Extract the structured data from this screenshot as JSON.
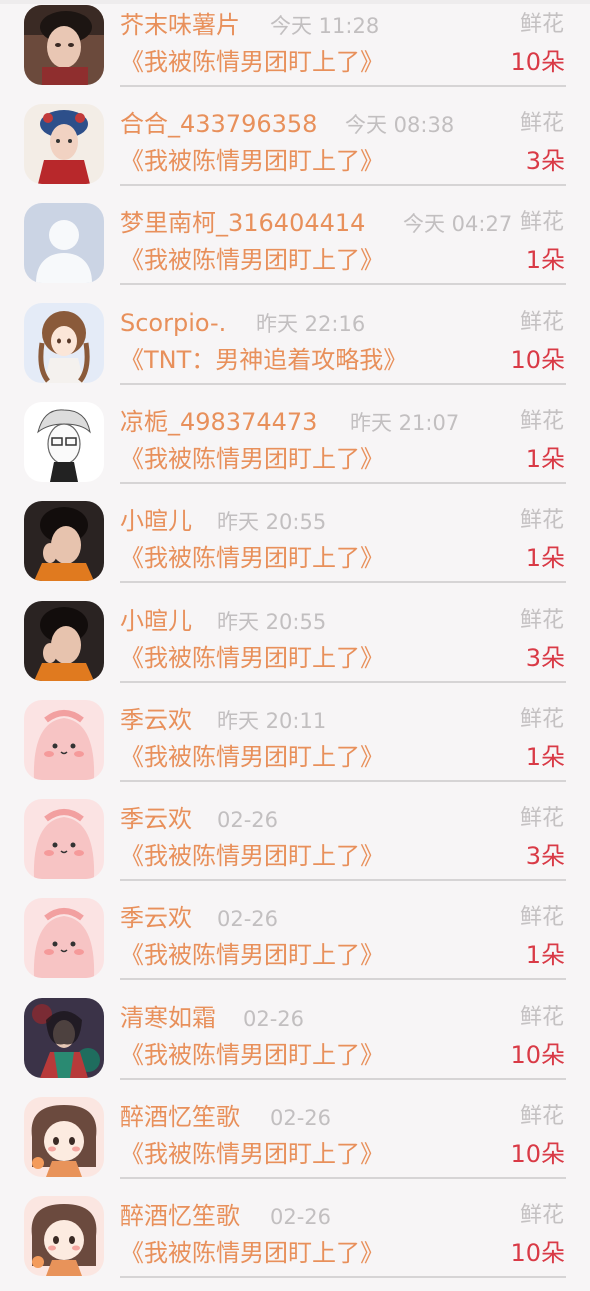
{
  "colors": {
    "name": "#e8905b",
    "time": "#c2bfc0",
    "gift_label": "#c4c1c2",
    "count": "#d93a46",
    "divider": "#d6d4d5",
    "background": "#f7f5f6"
  },
  "rows": [
    {
      "name": "芥末味薯片",
      "time": "今天 11:28",
      "gift": "鲜花",
      "book": "《我被陈情男团盯上了》",
      "count": "10朵",
      "avatar": "photo-male-avatar"
    },
    {
      "name": "合合_433796358",
      "time": "今天 08:38",
      "gift": "鲜花",
      "book": "《我被陈情男团盯上了》",
      "count": "3朵",
      "avatar": "photo-costume-avatar"
    },
    {
      "name": "梦里南柯_316404414",
      "time": "今天 04:27",
      "gift": "鲜花",
      "book": "《我被陈情男团盯上了》",
      "count": "1朵",
      "avatar": "default-person-avatar"
    },
    {
      "name": "Scorpio-.",
      "time": "昨天 22:16",
      "gift": "鲜花",
      "book": "《TNT：男神追着攻略我》",
      "count": "10朵",
      "avatar": "anime-girl-avatar"
    },
    {
      "name": "凉栀_498374473",
      "time": "昨天 21:07",
      "gift": "鲜花",
      "book": "《我被陈情男团盯上了》",
      "count": "1朵",
      "avatar": "sketch-boy-avatar"
    },
    {
      "name": "小暄儿",
      "time": "昨天 20:55",
      "gift": "鲜花",
      "book": "《我被陈情男团盯上了》",
      "count": "1朵",
      "avatar": "photo-boy-avatar"
    },
    {
      "name": "小暄儿",
      "time": "昨天 20:55",
      "gift": "鲜花",
      "book": "《我被陈情男团盯上了》",
      "count": "3朵",
      "avatar": "photo-boy-avatar"
    },
    {
      "name": "季云欢",
      "time": "昨天 20:11",
      "gift": "鲜花",
      "book": "《我被陈情男团盯上了》",
      "count": "1朵",
      "avatar": "pink-blob-avatar"
    },
    {
      "name": "季云欢",
      "time": "02-26",
      "gift": "鲜花",
      "book": "《我被陈情男团盯上了》",
      "count": "3朵",
      "avatar": "pink-blob-avatar"
    },
    {
      "name": "季云欢",
      "time": "02-26",
      "gift": "鲜花",
      "book": "《我被陈情男团盯上了》",
      "count": "1朵",
      "avatar": "pink-blob-avatar"
    },
    {
      "name": "清寒如霜",
      "time": "02-26",
      "gift": "鲜花",
      "book": "《我被陈情男团盯上了》",
      "count": "10朵",
      "avatar": "fantasy-art-avatar"
    },
    {
      "name": "醉酒忆笙歌",
      "time": "02-26",
      "gift": "鲜花",
      "book": "《我被陈情男团盯上了》",
      "count": "10朵",
      "avatar": "chibi-girl-avatar"
    },
    {
      "name": "醉酒忆笙歌",
      "time": "02-26",
      "gift": "鲜花",
      "book": "《我被陈情男团盯上了》",
      "count": "10朵",
      "avatar": "chibi-girl-avatar"
    }
  ]
}
